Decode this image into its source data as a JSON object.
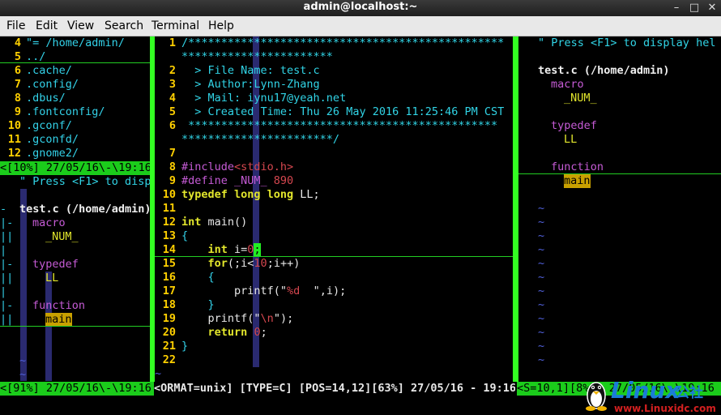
{
  "window": {
    "title": "admin@localhost:~",
    "min": "–",
    "max": "□",
    "close": "✕"
  },
  "menu": [
    "File",
    "Edit",
    "View",
    "Search",
    "Terminal",
    "Help"
  ],
  "left_top": {
    "lines": [
      {
        "n": "4",
        "t": "\"= /home/admin/",
        "cls": "dirhdr"
      },
      {
        "n": "5",
        "t": "../",
        "cls": "dir"
      },
      {
        "n": "6",
        "t": ".cache/",
        "cls": "dir"
      },
      {
        "n": "7",
        "t": ".config/",
        "cls": "dir"
      },
      {
        "n": "8",
        "t": ".dbus/",
        "cls": "dir"
      },
      {
        "n": "9",
        "t": ".fontconfig/",
        "cls": "dir"
      },
      {
        "n": "10",
        "t": ".gconf/",
        "cls": "dir"
      },
      {
        "n": "11",
        "t": ".gconfd/",
        "cls": "dir"
      },
      {
        "n": "12",
        "t": ".gnome2/",
        "cls": "dir"
      }
    ],
    "status": "<[10%] 27/05/16\\-\\19:16"
  },
  "left_bottom": {
    "help": "\" Press <F1> to disp",
    "file": "test.c (/home/admin)",
    "file_prefix": "-",
    "items": [
      {
        "g": "|-",
        "t": "macro",
        "k": "k"
      },
      {
        "g": "||",
        "t": "_NUM_",
        "k": "i"
      },
      {
        "g": "|",
        "t": "",
        "k": ""
      },
      {
        "g": "|-",
        "t": "typedef",
        "k": "k"
      },
      {
        "g": "||",
        "t": "LL",
        "k": "i"
      },
      {
        "g": "|",
        "t": "",
        "k": ""
      },
      {
        "g": "|-",
        "t": "function",
        "k": "k"
      },
      {
        "g": "||",
        "t": "main",
        "k": "hl"
      }
    ],
    "tildes": [
      "~",
      "~",
      "~"
    ],
    "status": "<[91%] 27/05/16\\-\\19:16"
  },
  "editor": {
    "lines": [
      {
        "n": "1",
        "segs": [
          {
            "c": "cm",
            "t": "/************************************************"
          }
        ]
      },
      {
        "n": "",
        "segs": [
          {
            "c": "cm",
            "t": "***********************"
          }
        ]
      },
      {
        "n": "2",
        "segs": [
          {
            "c": "cm",
            "t": "  > File Name: test.c"
          }
        ]
      },
      {
        "n": "3",
        "segs": [
          {
            "c": "cm",
            "t": "  > Author:Lynn-Zhang"
          }
        ]
      },
      {
        "n": "4",
        "segs": [
          {
            "c": "cm",
            "t": "  > Mail: iynu17@yeah.net"
          }
        ]
      },
      {
        "n": "5",
        "segs": [
          {
            "c": "cm",
            "t": "  > Created Time: Thu 26 May 2016 11:25:46 PM CST"
          }
        ]
      },
      {
        "n": "6",
        "segs": [
          {
            "c": "cm",
            "t": " ***********************************************"
          }
        ]
      },
      {
        "n": "",
        "segs": [
          {
            "c": "cm",
            "t": "***********************/"
          }
        ]
      },
      {
        "n": "7",
        "segs": []
      },
      {
        "n": "8",
        "segs": [
          {
            "c": "pp",
            "t": "#include"
          },
          {
            "c": "st",
            "t": "<stdio.h>"
          }
        ]
      },
      {
        "n": "9",
        "segs": [
          {
            "c": "pp",
            "t": "#define _NUM_ "
          },
          {
            "c": "nm",
            "t": "890"
          }
        ]
      },
      {
        "n": "10",
        "segs": [
          {
            "c": "ty",
            "t": "typedef long long"
          },
          {
            "c": "tx",
            "t": " LL;"
          }
        ]
      },
      {
        "n": "11",
        "segs": []
      },
      {
        "n": "12",
        "segs": [
          {
            "c": "ty",
            "t": "int"
          },
          {
            "c": "tx",
            "t": " main()"
          }
        ]
      },
      {
        "n": "13",
        "segs": [
          {
            "c": "br",
            "t": "{"
          }
        ]
      },
      {
        "n": "14",
        "segs": [
          {
            "c": "tx",
            "t": "    "
          },
          {
            "c": "ty",
            "t": "int"
          },
          {
            "c": "tx",
            "t": " i="
          },
          {
            "c": "nm",
            "t": "0"
          },
          {
            "c": "cursor",
            "t": ";"
          }
        ]
      },
      {
        "n": "15",
        "segs": [
          {
            "c": "tx",
            "t": "    "
          },
          {
            "c": "ty",
            "t": "for"
          },
          {
            "c": "tx",
            "t": "(;i<"
          },
          {
            "c": "nm",
            "t": "10"
          },
          {
            "c": "tx",
            "t": ";i++)"
          }
        ]
      },
      {
        "n": "16",
        "segs": [
          {
            "c": "tx",
            "t": "    "
          },
          {
            "c": "br",
            "t": "{"
          }
        ]
      },
      {
        "n": "17",
        "segs": [
          {
            "c": "tx",
            "t": "        printf(\""
          },
          {
            "c": "st",
            "t": "%d"
          },
          {
            "c": "tx",
            "t": "  \",i);"
          }
        ]
      },
      {
        "n": "18",
        "segs": [
          {
            "c": "tx",
            "t": "    "
          },
          {
            "c": "br",
            "t": "}"
          }
        ]
      },
      {
        "n": "19",
        "segs": [
          {
            "c": "tx",
            "t": "    printf(\""
          },
          {
            "c": "st",
            "t": "\\n"
          },
          {
            "c": "tx",
            "t": "\");"
          }
        ]
      },
      {
        "n": "20",
        "segs": [
          {
            "c": "tx",
            "t": "    "
          },
          {
            "c": "ty",
            "t": "return"
          },
          {
            "c": "tx",
            "t": " "
          },
          {
            "c": "nm",
            "t": "0"
          },
          {
            "c": "tx",
            "t": ";"
          }
        ]
      },
      {
        "n": "21",
        "segs": [
          {
            "c": "br",
            "t": "}"
          }
        ]
      },
      {
        "n": "22",
        "segs": []
      }
    ],
    "tilde": "~",
    "status": "<ORMAT=unix] [TYPE=C] [POS=14,12][63%] 27/05/16 - 19:16"
  },
  "right": {
    "help": "\" Press <F1> to display hel",
    "file": "test.c (/home/admin)",
    "items": [
      {
        "t": "macro",
        "k": "k",
        "ind": 1
      },
      {
        "t": "_NUM_",
        "k": "i",
        "ind": 2
      },
      {
        "t": "",
        "k": "",
        "ind": 0
      },
      {
        "t": "typedef",
        "k": "k",
        "ind": 1
      },
      {
        "t": "LL",
        "k": "i",
        "ind": 2
      },
      {
        "t": "",
        "k": "",
        "ind": 0
      },
      {
        "t": "function",
        "k": "k",
        "ind": 1
      },
      {
        "t": "main",
        "k": "hl",
        "ind": 2
      }
    ],
    "tildes": [
      "~",
      "~",
      "~",
      "~",
      "~",
      "~",
      "~",
      "~",
      "~",
      "~",
      "~",
      "~"
    ],
    "status": "<S=10,1][8%]  27/05/16\\-\\19:16"
  },
  "watermark": {
    "brand": "Linux",
    "suffix": "公社",
    "url": "www.Linuxidc.com"
  }
}
